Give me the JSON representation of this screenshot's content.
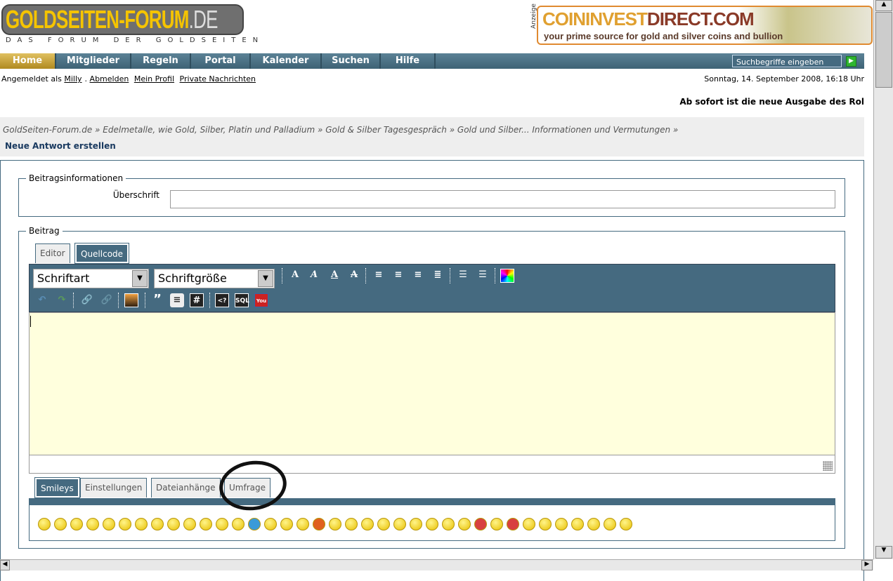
{
  "logo": {
    "main": "GOLDSEITEN-FORUM",
    "tld": ".DE",
    "tagline": "DAS FORUM DER GOLDSEITEN"
  },
  "ad": {
    "label": "Anzeige",
    "brand1": "COININVEST",
    "brand2": "DIRECT.COM",
    "slogan": "your prime source for gold and silver coins and bullion"
  },
  "nav": [
    {
      "label": "Home"
    },
    {
      "label": "Mitglieder"
    },
    {
      "label": "Regeln"
    },
    {
      "label": "Portal"
    },
    {
      "label": "Kalender"
    },
    {
      "label": "Suchen"
    },
    {
      "label": "Hilfe"
    }
  ],
  "search": {
    "placeholder": "Suchbegriffe eingeben",
    "go": "▶"
  },
  "user": {
    "prefix": "Angemeldet als",
    "name": "Milly",
    "links": [
      "Abmelden",
      "Mein Profil",
      "Private Nachrichten"
    ]
  },
  "date": "Sonntag, 14. September 2008, 16:18 Uhr",
  "marquee": "Ab sofort ist die neue Ausgabe des Rol",
  "breadcrumb": "GoldSeiten-Forum.de » Edelmetalle, wie Gold, Silber, Platin und Palladium » Gold & Silber Tagesgespräch » Gold und Silber... Informationen und Vermutungen »",
  "page_title": "Neue Antwort erstellen",
  "info": {
    "legend": "Beitragsinformationen",
    "subject_label": "Überschrift",
    "subject_value": ""
  },
  "post": {
    "legend": "Beitrag",
    "tabs": [
      "Editor",
      "Quellcode"
    ],
    "font": "Schriftart",
    "size": "Schriftgröße",
    "bottom_tabs": [
      "Smileys",
      "Einstellungen",
      "Dateianhänge",
      "Umfrage"
    ]
  },
  "smiley_colors": {
    "default": "#f0d000",
    "red": "#d84040",
    "blue": "#3a9ad8",
    "orange": "#e06020"
  },
  "smiley_count": 37
}
